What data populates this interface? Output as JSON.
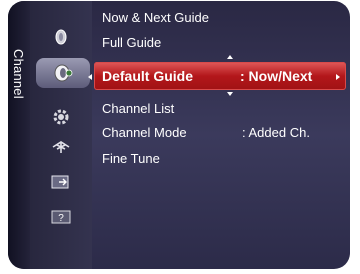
{
  "side_label": "Channel",
  "icons": [
    {
      "name": "antenna-dish-icon"
    },
    {
      "name": "channel-icon"
    },
    {
      "name": "settings-gear-icon"
    },
    {
      "name": "antenna-tower-icon"
    },
    {
      "name": "input-source-icon"
    },
    {
      "name": "help-icon"
    }
  ],
  "menu": {
    "now_next_guide": "Now & Next Guide",
    "full_guide": "Full Guide",
    "default_guide": {
      "label": "Default Guide",
      "value": ": Now/Next"
    },
    "channel_list": "Channel List",
    "channel_mode": {
      "label": "Channel Mode",
      "value": ":  Added Ch."
    },
    "fine_tune": "Fine Tune"
  },
  "colors": {
    "selected_bg": "#b3171b",
    "panel_bg": "#33324f"
  }
}
